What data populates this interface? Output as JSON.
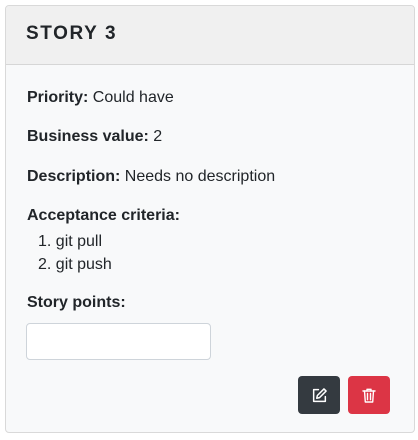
{
  "card": {
    "title": "STORY 3",
    "priority": {
      "label": "Priority:",
      "value": "Could have"
    },
    "business_value": {
      "label": "Business value:",
      "value": "2"
    },
    "description": {
      "label": "Description:",
      "value": "Needs no description"
    },
    "acceptance": {
      "label": "Acceptance criteria:",
      "items": [
        "1. git pull",
        "2. git push"
      ]
    },
    "story_points": {
      "label": "Story points:",
      "value": "",
      "placeholder": ""
    },
    "buttons": {
      "edit_icon": "edit-icon",
      "delete_icon": "trash-icon"
    }
  },
  "colors": {
    "edit_button": "#343a40",
    "delete_button": "#dc3545",
    "header_bg": "#f0f0f0",
    "card_bg": "#f8f9fa"
  }
}
